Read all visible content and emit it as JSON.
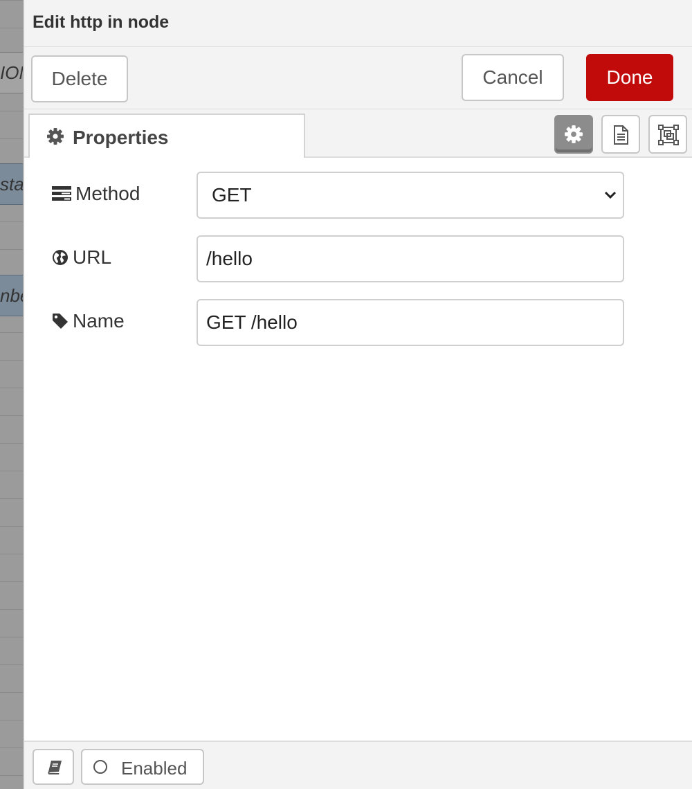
{
  "canvas": {
    "node_labels": [
      "ION",
      "sta",
      "nbe"
    ]
  },
  "dialog": {
    "title": "Edit http in node",
    "buttons": {
      "delete": "Delete",
      "cancel": "Cancel",
      "done": "Done"
    },
    "tabs": {
      "active_tab": "Properties",
      "tab_buttons": [
        "properties-icon",
        "description-icon",
        "appearance-icon"
      ]
    },
    "form": {
      "method": {
        "label": "Method",
        "value": "GET",
        "options": [
          "GET"
        ]
      },
      "url": {
        "label": "URL",
        "value": "/hello"
      },
      "name": {
        "label": "Name",
        "value": "GET /hello"
      }
    },
    "footer": {
      "enabled_label": "Enabled"
    }
  },
  "colors": {
    "done_button": "#c10b0b",
    "active_tab_button": "#8c8c8c"
  }
}
